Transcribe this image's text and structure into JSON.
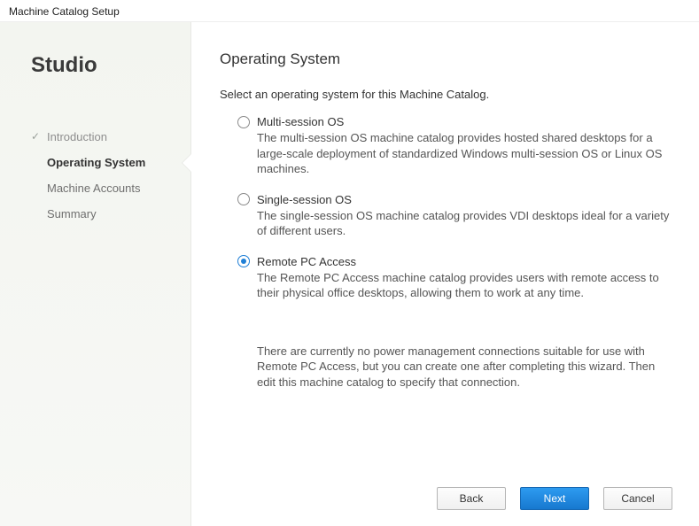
{
  "window": {
    "title": "Machine Catalog Setup"
  },
  "brand": "Studio",
  "nav": {
    "items": [
      {
        "label": "Introduction",
        "state": "completed"
      },
      {
        "label": "Operating System",
        "state": "active"
      },
      {
        "label": "Machine Accounts",
        "state": "upcoming"
      },
      {
        "label": "Summary",
        "state": "upcoming"
      }
    ]
  },
  "page": {
    "heading": "Operating System",
    "intro": "Select an operating system for this Machine Catalog.",
    "options": [
      {
        "id": "multi-session-os",
        "label": "Multi-session OS",
        "description": "The multi-session OS machine catalog provides hosted shared desktops for a large-scale deployment of standardized Windows multi-session OS or Linux OS machines.",
        "selected": false
      },
      {
        "id": "single-session-os",
        "label": "Single-session OS",
        "description": "The single-session OS machine catalog provides VDI desktops ideal for a variety of different users.",
        "selected": false
      },
      {
        "id": "remote-pc-access",
        "label": "Remote PC Access",
        "description": "The Remote PC Access machine catalog provides users with remote access to their physical office desktops, allowing them to work at any time.",
        "selected": true
      }
    ],
    "note": "There are currently no power management connections suitable for use with Remote PC Access, but you can create one after completing this wizard. Then edit this machine catalog to specify that connection."
  },
  "buttons": {
    "back": "Back",
    "next": "Next",
    "cancel": "Cancel"
  }
}
